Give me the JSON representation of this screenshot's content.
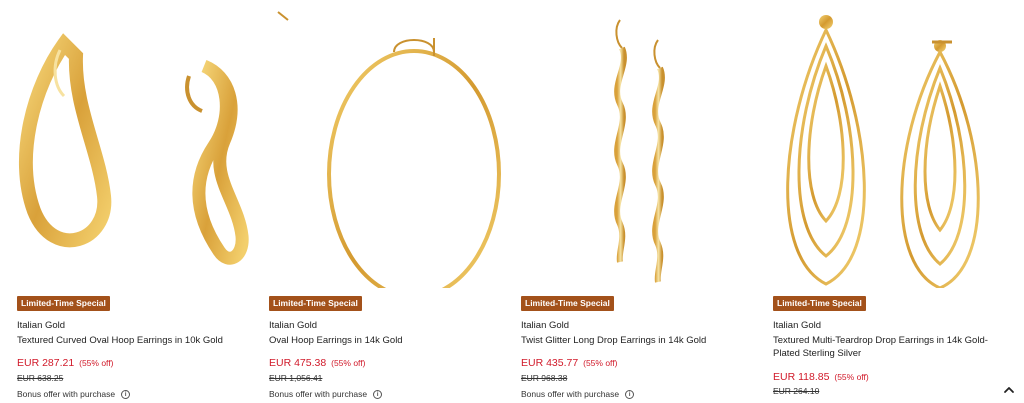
{
  "products": [
    {
      "badge": "Limited-Time Special",
      "brand": "Italian Gold",
      "title": "Textured Curved Oval Hoop Earrings in 10k Gold",
      "price": "EUR 287.21",
      "discount": "(55% off)",
      "original_price": "EUR 638.25",
      "bonus": "Bonus offer with purchase"
    },
    {
      "badge": "Limited-Time Special",
      "brand": "Italian Gold",
      "title": "Oval Hoop Earrings in 14k Gold",
      "price": "EUR 475.38",
      "discount": "(55% off)",
      "original_price": "EUR 1,056.41",
      "bonus": "Bonus offer with purchase"
    },
    {
      "badge": "Limited-Time Special",
      "brand": "Italian Gold",
      "title": "Twist Glitter Long Drop Earrings in 14k Gold",
      "price": "EUR 435.77",
      "discount": "(55% off)",
      "original_price": "EUR 968.38",
      "bonus": "Bonus offer with purchase"
    },
    {
      "badge": "Limited-Time Special",
      "brand": "Italian Gold",
      "title": "Textured Multi-Teardrop Drop Earrings in 14k Gold-Plated Sterling Silver",
      "price": "EUR 118.85",
      "discount": "(55% off)",
      "original_price": "EUR 264.10",
      "bonus": ""
    }
  ],
  "info_icon_glyph": "i",
  "colors": {
    "badge_bg": "#a3511a",
    "sale_price": "#d11a2a",
    "gold": "#d9a93a"
  },
  "icons": {
    "info": "info-circle-icon",
    "scroll": "chevron-up-icon"
  }
}
